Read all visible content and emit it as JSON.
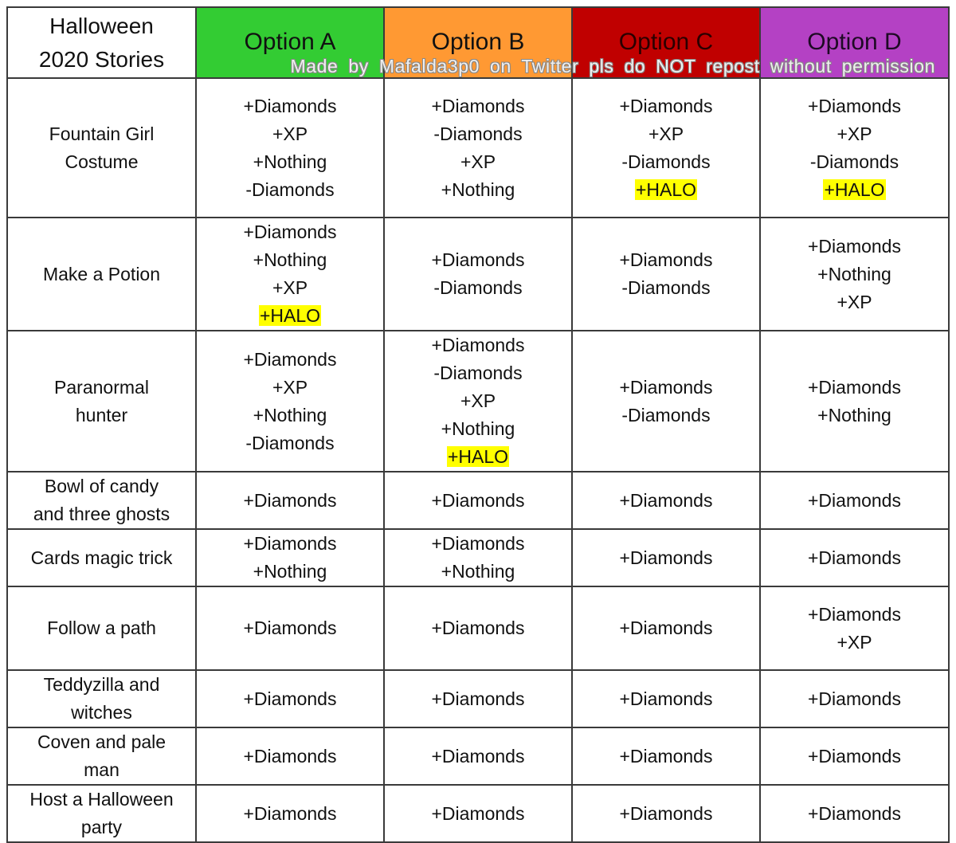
{
  "header": {
    "title_line1": "Halloween",
    "title_line2": "2020 Stories",
    "options": [
      {
        "label": "Option A",
        "color": "#33cc33"
      },
      {
        "label": "Option B",
        "color": "#ff9933"
      },
      {
        "label": "Option C",
        "color": "#c00000"
      },
      {
        "label": "Option D",
        "color": "#b441c4"
      }
    ],
    "watermark": "Made by Mafalda3p0 on Twitter pls do NOT repost without permission"
  },
  "highlight_color": "#ffff00",
  "rows": [
    {
      "story": [
        "Fountain Girl",
        "Costume"
      ],
      "options": [
        [
          "+Diamonds",
          "+XP",
          "+Nothing",
          "-Diamonds"
        ],
        [
          "+Diamonds",
          "-Diamonds",
          "+XP",
          "+Nothing"
        ],
        [
          "+Diamonds",
          "+XP",
          "-Diamonds",
          "+HALO"
        ],
        [
          "+Diamonds",
          "+XP",
          "-Diamonds",
          "+HALO"
        ]
      ]
    },
    {
      "story": [
        "Make a Potion"
      ],
      "options": [
        [
          "+Diamonds",
          "+Nothing",
          "+XP",
          "+HALO"
        ],
        [
          "+Diamonds",
          "-Diamonds"
        ],
        [
          "+Diamonds",
          "-Diamonds"
        ],
        [
          "+Diamonds",
          "+Nothing",
          "+XP"
        ]
      ]
    },
    {
      "story": [
        "Paranormal",
        "hunter"
      ],
      "options": [
        [
          "+Diamonds",
          "+XP",
          "+Nothing",
          "-Diamonds"
        ],
        [
          "+Diamonds",
          "-Diamonds",
          "+XP",
          "+Nothing",
          "+HALO"
        ],
        [
          "+Diamonds",
          "-Diamonds"
        ],
        [
          "+Diamonds",
          "+Nothing"
        ]
      ]
    },
    {
      "story": [
        "Bowl of candy",
        "and three ghosts"
      ],
      "options": [
        [
          "+Diamonds"
        ],
        [
          "+Diamonds"
        ],
        [
          "+Diamonds"
        ],
        [
          "+Diamonds"
        ]
      ]
    },
    {
      "story": [
        "Cards magic trick"
      ],
      "options": [
        [
          "+Diamonds",
          "+Nothing"
        ],
        [
          "+Diamonds",
          "+Nothing"
        ],
        [
          "+Diamonds"
        ],
        [
          "+Diamonds"
        ]
      ]
    },
    {
      "story": [
        "Follow a path"
      ],
      "options": [
        [
          "+Diamonds"
        ],
        [
          "+Diamonds"
        ],
        [
          "+Diamonds"
        ],
        [
          "+Diamonds",
          "+XP"
        ]
      ]
    },
    {
      "story": [
        "Teddyzilla and",
        "witches"
      ],
      "options": [
        [
          "+Diamonds"
        ],
        [
          "+Diamonds"
        ],
        [
          "+Diamonds"
        ],
        [
          "+Diamonds"
        ]
      ]
    },
    {
      "story": [
        "Coven and pale",
        "man"
      ],
      "options": [
        [
          "+Diamonds"
        ],
        [
          "+Diamonds"
        ],
        [
          "+Diamonds"
        ],
        [
          "+Diamonds"
        ]
      ]
    },
    {
      "story": [
        "Host a Halloween",
        "party"
      ],
      "options": [
        [
          "+Diamonds"
        ],
        [
          "+Diamonds"
        ],
        [
          "+Diamonds"
        ],
        [
          "+Diamonds"
        ]
      ]
    }
  ]
}
